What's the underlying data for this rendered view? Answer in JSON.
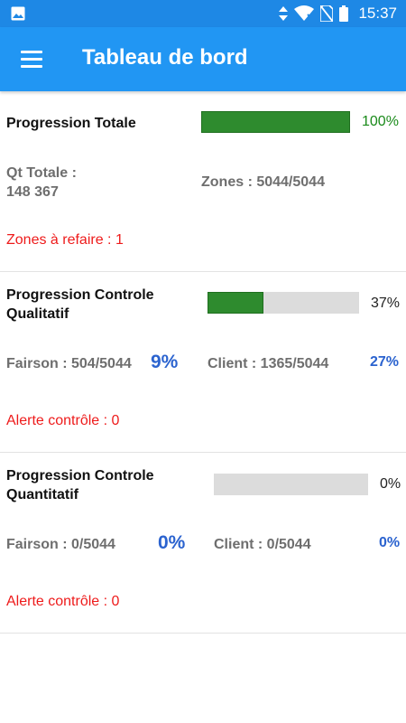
{
  "status_bar": {
    "time": "15:37",
    "icons": [
      "gallery-icon",
      "data-transfer-icon",
      "wifi-icon",
      "no-sim-icon",
      "battery-icon"
    ]
  },
  "app_bar": {
    "title": "Tableau de bord",
    "menu_icon": "hamburger-menu-icon"
  },
  "colors": {
    "app_bar": "#2196f3",
    "status_bar": "#1e88e5",
    "progress_fill": "#2e8b2e",
    "progress_track": "#dcdcdc",
    "total_percent": "#1a8a1a",
    "alert": "#ee1b1b",
    "percent_blue": "#2b63cf"
  },
  "sections": {
    "total": {
      "title": "Progression Totale",
      "progress": 1.0,
      "percent_label": "100%",
      "qt_label": "Qt Totale :",
      "qt_value": "148 367",
      "zones": "Zones : 5044/5044",
      "alert": "Zones à refaire : 1"
    },
    "qualitatif": {
      "title_line1": "Progression Controle",
      "title_line2": "Qualitatif",
      "progress": 0.37,
      "percent_label": "37%",
      "fairson": "Fairson : 504/5044",
      "fairson_pct": "9%",
      "client": "Client : 1365/5044",
      "client_pct": "27%",
      "alert": "Alerte contrôle : 0"
    },
    "quantitatif": {
      "title_line1": "Progression Controle",
      "title_line2": "Quantitatif",
      "progress": 0.0,
      "percent_label": "0%",
      "fairson": "Fairson : 0/5044",
      "fairson_pct": "0%",
      "client": "Client : 0/5044",
      "client_pct": "0%",
      "alert": "Alerte contrôle : 0"
    }
  }
}
